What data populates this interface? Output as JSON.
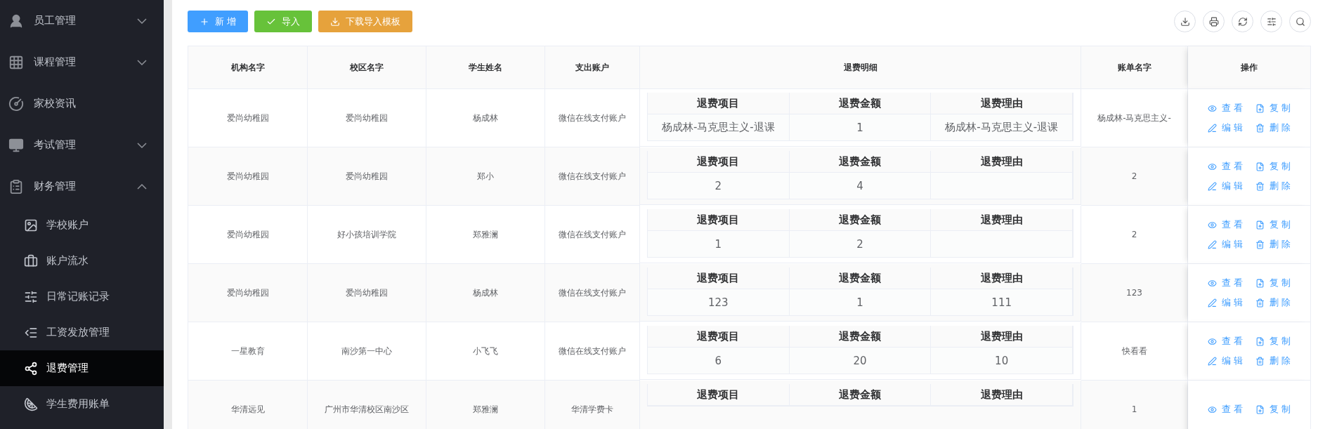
{
  "sidebar": {
    "items": [
      {
        "label": "员工管理",
        "expanded": false
      },
      {
        "label": "课程管理",
        "expanded": false
      },
      {
        "label": "家校资讯"
      },
      {
        "label": "考试管理",
        "expanded": false
      },
      {
        "label": "财务管理",
        "expanded": true,
        "children": [
          {
            "label": "学校账户",
            "selected": false
          },
          {
            "label": "账户流水",
            "selected": false
          },
          {
            "label": "日常记账记录",
            "selected": false
          },
          {
            "label": "工资发放管理",
            "selected": false
          },
          {
            "label": "退费管理",
            "selected": true
          },
          {
            "label": "学生费用账单",
            "selected": false
          }
        ]
      }
    ]
  },
  "toolbar": {
    "buttons": [
      {
        "label": "新 增",
        "kind": "primary"
      },
      {
        "label": "导入",
        "kind": "success"
      },
      {
        "label": "下载导入模板",
        "kind": "warning"
      }
    ]
  },
  "table": {
    "columns": [
      "机构名字",
      "校区名字",
      "学生姓名",
      "支出账户",
      "退费明细",
      "账单名字",
      "操作"
    ],
    "rows": [
      {
        "org": "爱尚幼稚园",
        "campus": "爱尚幼稚园",
        "student": "杨成林",
        "account": "微信在线支付账户",
        "detail_headers": [
          "退费项目",
          "退费金额",
          "退费理由"
        ],
        "details": [
          {
            "item": "杨成林-马克思主义-退课",
            "amount": "1",
            "reason": "杨成林-马克思主义-退课"
          }
        ],
        "bill": "杨成林-马克思主义-",
        "actions": [
          "查 看",
          "复 制",
          "编 辑",
          "删 除"
        ]
      },
      {
        "org": "爱尚幼稚园",
        "campus": "爱尚幼稚园",
        "student": "郑小",
        "account": "微信在线支付账户",
        "detail_headers": [
          "退费项目",
          "退费金额",
          "退费理由"
        ],
        "details": [
          {
            "item": "2",
            "amount": "4"
          }
        ],
        "bill": "2",
        "actions": [
          "查 看",
          "复 制",
          "编 辑",
          "删 除"
        ]
      },
      {
        "org": "爱尚幼稚园",
        "campus": "好小孩培训学院",
        "student": "郑雅澜",
        "account": "微信在线支付账户",
        "detail_headers": [
          "退费项目",
          "退费金额",
          "退费理由"
        ],
        "details": [
          {
            "item": "1",
            "amount": "2"
          }
        ],
        "bill": "2",
        "actions": [
          "查 看",
          "复 制",
          "编 辑",
          "删 除"
        ]
      },
      {
        "org": "爱尚幼稚园",
        "campus": "爱尚幼稚园",
        "student": "杨成林",
        "account": "微信在线支付账户",
        "detail_headers": [
          "退费项目",
          "退费金额",
          "退费理由"
        ],
        "details": [
          {
            "item": "123",
            "amount": "1",
            "reason": "111"
          }
        ],
        "bill": "123",
        "actions": [
          "查 看",
          "复 制",
          "编 辑",
          "删 除"
        ]
      },
      {
        "org": "一星教育",
        "campus": "南沙第一中心",
        "student": "小飞飞",
        "account": "微信在线支付账户",
        "detail_headers": [
          "退费项目",
          "退费金额",
          "退费理由"
        ],
        "details": [
          {
            "item": "6",
            "amount": "20",
            "reason": "10"
          }
        ],
        "bill": "快看看",
        "actions": [
          "查 看",
          "复 制",
          "编 辑",
          "删 除"
        ]
      },
      {
        "org": "华清远见",
        "campus": "广州市华清校区南沙区",
        "student": "郑雅澜",
        "account": "华清学费卡",
        "detail_headers": [
          "退费项目",
          "退费金额",
          "退费理由"
        ],
        "bill": "1",
        "actions": [
          "查 看",
          "复 制"
        ]
      }
    ]
  }
}
